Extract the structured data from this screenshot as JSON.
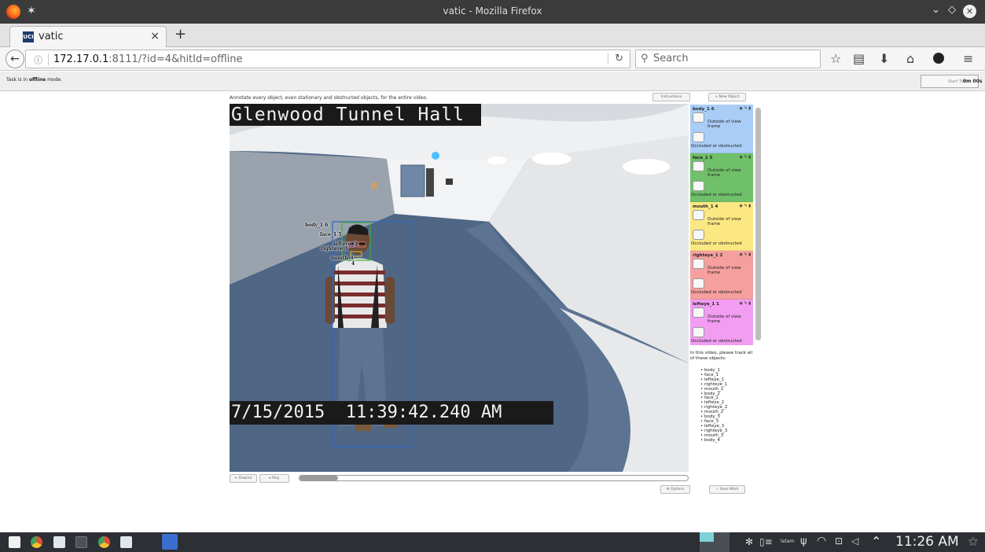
{
  "window": {
    "title": "vatic - Mozilla Firefox",
    "pin_icon": "pin-icon",
    "controls": [
      "chevron-down-icon",
      "restore-icon",
      "close-icon"
    ]
  },
  "tab": {
    "title": "vatic",
    "favicon_text": "UCI",
    "close": "×",
    "new_tab": "+"
  },
  "navbar": {
    "url_host": "172.17.0.1",
    "url_rest": ":8111/?id=4&hitId=offline",
    "search_placeholder": "Search",
    "icons": [
      "bookmark-star-icon",
      "reading-list-icon",
      "download-icon",
      "home-icon",
      "extension-icon",
      "menu-icon"
    ]
  },
  "status": {
    "text_prefix": "Task is in ",
    "text_mode": "offline",
    "text_suffix": " mode.",
    "start_timer": "Start Tim",
    "timer": "0m 00s"
  },
  "page": {
    "instruction": "Annotate every object, even stationary and obstructed objects, for the entire video.",
    "instructions_button": "Instructions",
    "new_object_button": "+ New Object",
    "rewind_button": "Rewind",
    "play_button": "Play",
    "options_button": "Options",
    "save_button": "Save Work",
    "playback_progress": 0.1
  },
  "video": {
    "overlay_title": "Glenwood Tunnel Hall",
    "overlay_timestamp": "7/15/2015  11:39:42.240 AM",
    "box_labels": [
      "body_1 6",
      "face_1 5",
      "lefteye_1",
      "righteye_1",
      "mouth_1",
      "4",
      "3"
    ]
  },
  "objects": [
    {
      "name": "body_1 6",
      "color": "#a9cdf7",
      "outside": "Outside of view frame",
      "occluded": "Occluded or obstructed"
    },
    {
      "name": "face_1 5",
      "color": "#70c06a",
      "outside": "Outside of view frame",
      "occluded": "Occluded or obstructed"
    },
    {
      "name": "mouth_1 4",
      "color": "#fce882",
      "outside": "Outside of view frame",
      "occluded": "Occluded or obstructed"
    },
    {
      "name": "righteye_1 2",
      "color": "#f59f9f",
      "outside": "Outside of view frame",
      "occluded": "Occluded or obstructed"
    },
    {
      "name": "lefteye_1 1",
      "color": "#f29cf2",
      "outside": "Outside of view frame",
      "occluded": "Occluded or obstructed"
    }
  ],
  "track_intro": "In this video, please track all of these objects:",
  "track_list": [
    "body_1",
    "face_1",
    "lefteye_1",
    "righteye_1",
    "mouth_1",
    "body_2",
    "face_2",
    "lefteye_2",
    "righteye_2",
    "mouth_2",
    "body_3",
    "face_3",
    "lefteye_3",
    "righteye_3",
    "mouth_3",
    "body_4"
  ],
  "taskbar": {
    "apps": [
      "menu-grid-icon",
      "chrome-icon",
      "files-icon",
      "settings-icon",
      "chrome-icon",
      "files-icon",
      "firefox-icon"
    ],
    "tray_icons": [
      "bluetooth-icon",
      "battery-icon",
      "usb-icon",
      "wifi-icon",
      "clipboard-icon",
      "volume-icon",
      "chevron-up-icon"
    ],
    "lang": "latam",
    "clock": "11:26 AM"
  }
}
